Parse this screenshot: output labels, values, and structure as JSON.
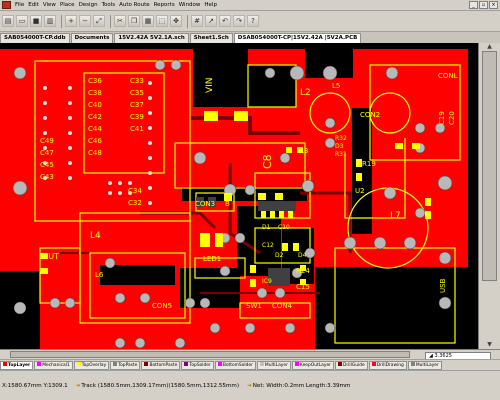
{
  "menubar": {
    "items": [
      "File",
      "Edit",
      "View",
      "Place",
      "Design",
      "Tools",
      "Auto Route",
      "Reports",
      "Window",
      "Help"
    ]
  },
  "doc_tabs": [
    {
      "label": "SAB054000T-CP.ddb",
      "active": false
    },
    {
      "label": "Documents",
      "active": false
    },
    {
      "label": "15V2.42A 5V2.1A.sch",
      "active": false
    },
    {
      "label": "Sheet1.Sch",
      "active": false
    },
    {
      "label": "DSAB054000T-CP|15V2.42A |5V2A.PCB",
      "active": true
    }
  ],
  "pcb": {
    "labels": {
      "c36": "C36",
      "c38": "C38",
      "c40": "C40",
      "c42": "C42",
      "c44": "C44",
      "c46": "C46",
      "c48": "C48",
      "c33": "C33",
      "c35": "C35",
      "c37": "C37",
      "c39": "C39",
      "c41": "C41",
      "c49": "C49",
      "c47": "C47",
      "c45": "C45",
      "c43": "C43",
      "c34": "C34",
      "c32": "C32",
      "vin": "VIN",
      "l2": "L2",
      "l5": "L5",
      "conl": "CONL",
      "con2": "CON2",
      "c8": "C8",
      "l3": "L3",
      "r32": "R32",
      "r31": "R31",
      "d3": "D3",
      "c19": "C19",
      "c20": "C20",
      "u2": "U2",
      "r19": "R19",
      "l7": "L7",
      "con3": "CON3",
      "b": "B",
      "l4": "L4",
      "d1": "D1",
      "d2": "D2",
      "c10": "C10",
      "d4": "D4",
      "c12": "C12",
      "ic9": "IC9",
      "led1": "LED1",
      "r24": "R24",
      "c15": "C15",
      "out": "OUT",
      "l6": "L6",
      "con5": "CON5",
      "sw1": "SW1",
      "con4": "CON4",
      "usb": "USB"
    }
  },
  "layer_tabs": [
    {
      "label": "TopLayer",
      "active": true,
      "color": "#ff0000"
    },
    {
      "label": "Mechanical1",
      "active": false,
      "color": "#ff00ff"
    },
    {
      "label": "TopOverlay",
      "active": false,
      "color": "#ffff00"
    },
    {
      "label": "TopPaste",
      "active": false,
      "color": "#808080"
    },
    {
      "label": "BottomPaste",
      "active": false,
      "color": "#800000"
    },
    {
      "label": "TopSolder",
      "active": false,
      "color": "#800080"
    },
    {
      "label": "BottomSolder",
      "active": false,
      "color": "#ff00ff"
    },
    {
      "label": "MultiLayer",
      "active": false,
      "color": "#c0c0c0"
    },
    {
      "label": "KeepOutLayer",
      "active": false,
      "color": "#ff00ff"
    },
    {
      "label": "DrillGuide",
      "active": false,
      "color": "#800000"
    },
    {
      "label": "DrillDrawing",
      "active": false,
      "color": "#ff002a"
    },
    {
      "label": "MultiLayer",
      "active": false,
      "color": "#808080"
    }
  ],
  "zoom_readout": "3.3625",
  "status": {
    "coords": "X:1580.67mm Y:1309.1",
    "track": "Track (1580.5mm,1309.17mm)(1580.5mm,1312.55mm)",
    "net": "Net: Width:0.2mm Length:3.39mm"
  },
  "colors": {
    "board": "#ff0000",
    "silk": "#ffff00",
    "pad": "#c0c0c0",
    "background": "#000000"
  }
}
